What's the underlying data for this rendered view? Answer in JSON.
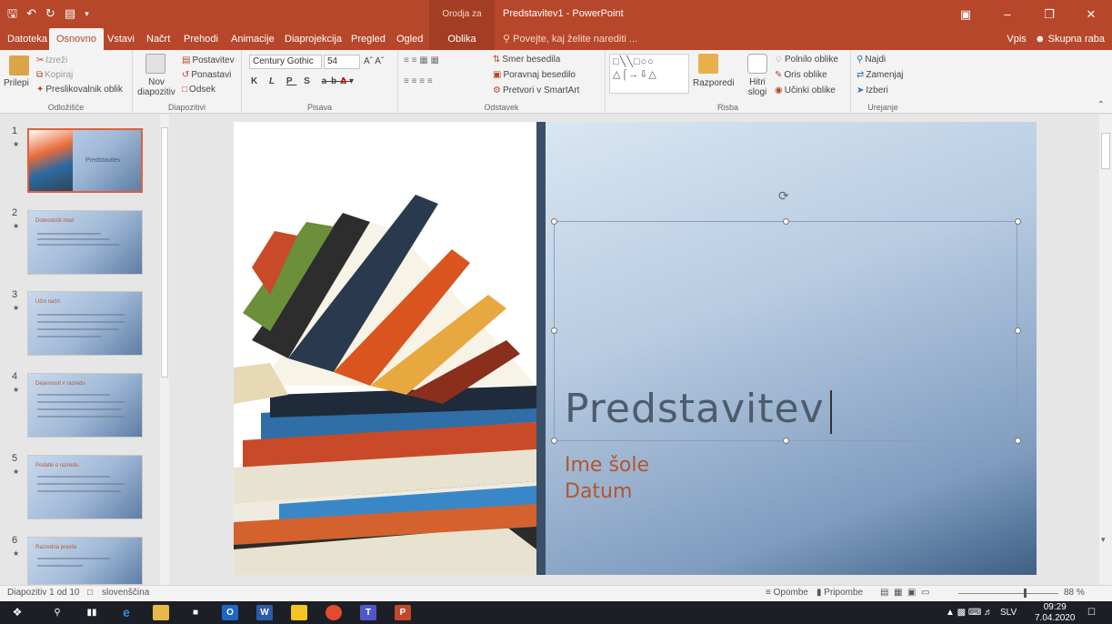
{
  "titlebar": {
    "contextual": "Orodja za risanje",
    "title": "Predstavitev1 - PowerPoint"
  },
  "tabs": [
    {
      "label": "Datoteka"
    },
    {
      "label": "Osnovno"
    },
    {
      "label": "Vstavi"
    },
    {
      "label": "Načrt"
    },
    {
      "label": "Prehodi"
    },
    {
      "label": "Animacije"
    },
    {
      "label": "Diaprojekcija"
    },
    {
      "label": "Pregled"
    },
    {
      "label": "Ogled"
    },
    {
      "label": "Oblika"
    }
  ],
  "tell_me": "Povejte, kaj želite narediti ...",
  "sign_in": "Vpis",
  "share": "Skupna raba",
  "ribbon": {
    "clipboard": {
      "paste": "Prilepi",
      "cut": "Izreži",
      "copy": "Kopiraj",
      "format_painter": "Preslikovalnik oblik",
      "label": "Odložišče"
    },
    "slides": {
      "new_slide": "Nov diapozitiv",
      "layout": "Postavitev",
      "reset": "Ponastavi",
      "section": "Odsek",
      "label": "Diapozitivi"
    },
    "font": {
      "name": "Century Gothic",
      "size": "54",
      "label": "Pisava"
    },
    "paragraph": {
      "text_direction": "Smer besedila",
      "align_text": "Poravnaj besedilo",
      "smartart": "Pretvori v SmartArt",
      "label": "Odstavek"
    },
    "drawing": {
      "arrange": "Razporedi",
      "quick_styles": "Hitri slogi",
      "fill": "Polnilo oblike",
      "outline": "Oris oblike",
      "effects": "Učinki oblike",
      "label": "Risba"
    },
    "editing": {
      "find": "Najdi",
      "replace": "Zamenjaj",
      "select": "Izberi",
      "label": "Urejanje"
    }
  },
  "thumbnails": [
    {
      "num": "1",
      "title": "Predstavitev"
    },
    {
      "num": "2",
      "title": "Dobrodošli med"
    },
    {
      "num": "3",
      "title": "Učni načrt"
    },
    {
      "num": "4",
      "title": "Dejavnosti v razredu"
    },
    {
      "num": "5",
      "title": "Podatki o razredu"
    },
    {
      "num": "6",
      "title": "Razredna pravila"
    }
  ],
  "slide": {
    "title": "Predstavitev",
    "school": "Ime šole",
    "date": "Datum"
  },
  "status": {
    "slide_count": "Diapozitiv 1 od 10",
    "language": "slovenščina",
    "notes": "Opombe",
    "comments": "Pripombe",
    "zoom": "88 %"
  },
  "taskbar": {
    "lang": "SLV",
    "time": "09:29",
    "date": "7.04.2020"
  }
}
